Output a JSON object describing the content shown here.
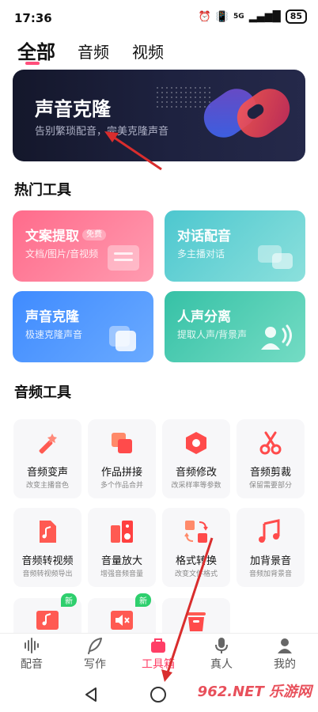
{
  "status": {
    "time": "17:36",
    "network": "5G",
    "battery": "85"
  },
  "tabs": [
    {
      "label": "全部"
    },
    {
      "label": "音频"
    },
    {
      "label": "视频"
    }
  ],
  "banner": {
    "title": "声音克隆",
    "subtitle": "告别繁琐配音，完美克隆声音"
  },
  "hot_tools": {
    "title": "热门工具",
    "free_badge": "免费",
    "cards": [
      {
        "title": "文案提取",
        "subtitle": "文档/图片/音视频"
      },
      {
        "title": "对话配音",
        "subtitle": "多主播对话"
      },
      {
        "title": "声音克隆",
        "subtitle": "极速克隆声音"
      },
      {
        "title": "人声分离",
        "subtitle": "提取人声/背景声"
      }
    ]
  },
  "audio_tools": {
    "title": "音频工具",
    "new_badge": "新",
    "items": [
      {
        "name": "音频变声",
        "desc": "改变主播音色",
        "icon": "magic-wand-icon"
      },
      {
        "name": "作品拼接",
        "desc": "多个作品合并",
        "icon": "merge-icon"
      },
      {
        "name": "音频修改",
        "desc": "改采样率等参数",
        "icon": "hex-nut-icon"
      },
      {
        "name": "音频剪裁",
        "desc": "保留需要部分",
        "icon": "scissors-icon"
      },
      {
        "name": "音频转视频",
        "desc": "音频转视频导出",
        "icon": "music-file-icon"
      },
      {
        "name": "音量放大",
        "desc": "增强音频音量",
        "icon": "speaker-icon"
      },
      {
        "name": "格式转换",
        "desc": "改变文件格式",
        "icon": "convert-icon"
      },
      {
        "name": "加背景音",
        "desc": "音频加背景音",
        "icon": "music-note-icon"
      }
    ]
  },
  "bottom_nav": [
    {
      "label": "配音",
      "icon": "waveform-icon"
    },
    {
      "label": "写作",
      "icon": "feather-icon"
    },
    {
      "label": "工具箱",
      "icon": "toolbox-icon"
    },
    {
      "label": "真人",
      "icon": "microphone-icon"
    },
    {
      "label": "我的",
      "icon": "person-icon"
    }
  ],
  "watermark": "962.NET 乐游网",
  "colors": {
    "accent": "#ff3e66",
    "banner_bg": "#1a1d33",
    "arrow": "#d92d2d"
  }
}
